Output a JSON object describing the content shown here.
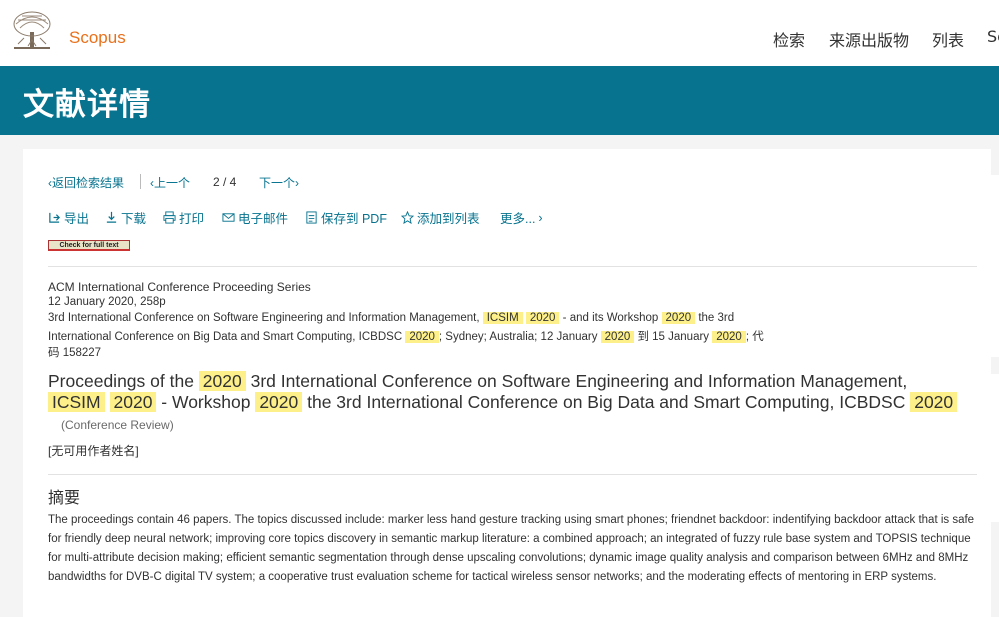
{
  "header": {
    "brand": "Scopus",
    "nav": [
      "检索",
      "来源出版物",
      "列表",
      "Sc"
    ]
  },
  "banner": {
    "title": "文献详情"
  },
  "pager": {
    "back": "返回检索结果",
    "prev": "上一个",
    "position": "2 / 4",
    "next": "下一个"
  },
  "toolbar": {
    "export": "导出",
    "download": "下载",
    "print": "打印",
    "email": "电子邮件",
    "save_pdf": "保存到 PDF",
    "add_list": "添加到列表",
    "more": "更多..."
  },
  "check_full_text": "Check for full text",
  "source": {
    "series": "ACM International Conference Proceeding Series",
    "date_pages": "12 January 2020, 258p",
    "line1_a": "3rd International Conference on Software Engineering and Information Management, ",
    "line1_hl1": "ICSIM",
    "line1_hl2": "2020",
    "line1_b": " - and its Workshop ",
    "line1_hl3": "2020",
    "line1_c": " the 3rd",
    "line2_a": "International Conference on Big Data and Smart Computing, ICBDSC ",
    "line2_hl1": "2020",
    "line2_b": "; Sydney; Australia; 12 January ",
    "line2_hl2": "2020",
    "line2_c": " 到 15 January ",
    "line2_hl3": "2020",
    "line2_d": "; 代",
    "line3": "码 158227"
  },
  "doc_title": {
    "p1": "Proceedings of the ",
    "h1": "2020",
    "p2": " 3rd International Conference on Software Engineering and Information Management,",
    "h2": "ICSIM",
    "p3": " ",
    "h3": "2020",
    "p4": " - Workshop ",
    "h4": "2020",
    "p5": " the 3rd International Conference on Big Data and Smart Computing, ICBDSC ",
    "h5": "2020"
  },
  "doc_type": "(Conference Review)",
  "author": "[无可用作者姓名]",
  "abstract": {
    "heading": "摘要",
    "text": "The proceedings contain 46 papers. The topics discussed include: marker less hand gesture tracking using smart phones; friendnet backdoor: indentifying backdoor attack that is safe for friendly deep neural network; improving core topics discovery in semantic markup literature: a combined approach; an integrated of fuzzy rule base system and TOPSIS technique for multi-attribute decision making; efficient semantic segmentation through dense upscaling convolutions; dynamic image quality analysis and comparison between 6MHz and 8MHz bandwidths for DVB-C digital TV system; a cooperative trust evaluation scheme for tactical wireless sensor networks; and the moderating effects of mentoring in ERP systems."
  },
  "colors": {
    "brand": "#e9711c",
    "banner": "#07738f",
    "link": "#07738f",
    "highlight": "#fdf08a"
  }
}
